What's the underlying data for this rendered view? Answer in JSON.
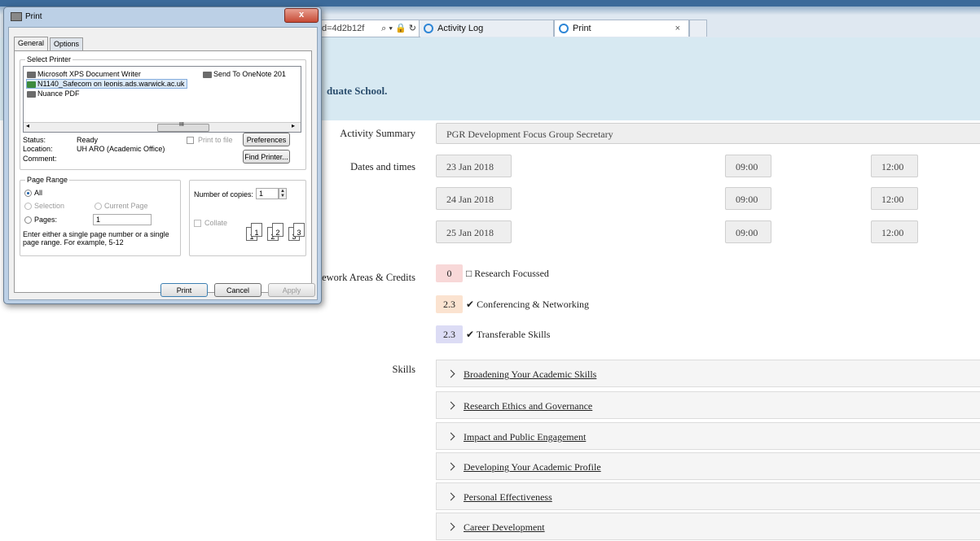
{
  "browser": {
    "address_fragment": "d=4d2b12f",
    "address_tools": "⌕ ▾ 🔒 ↻",
    "tabs": [
      {
        "label": "Activity Log",
        "active": false
      },
      {
        "label": "Print",
        "active": true,
        "close": "×"
      }
    ]
  },
  "page": {
    "header_fragment": "duate School."
  },
  "form": {
    "activity_summary_label": "Activity Summary",
    "activity_summary_value": "PGR Development Focus Group Secretary",
    "dates_label": "Dates and times",
    "dates": [
      {
        "date": "23 Jan 2018",
        "start": "09:00",
        "end": "12:00"
      },
      {
        "date": "24 Jan 2018",
        "start": "09:00",
        "end": "12:00"
      },
      {
        "date": "25 Jan 2018",
        "start": "09:00",
        "end": "12:00"
      }
    ],
    "credits_label": "mework Areas & Credits",
    "credits": [
      {
        "value": "0",
        "mark": "□",
        "label": "Research Focussed",
        "color": "#f8d8d8"
      },
      {
        "value": "2.3",
        "mark": "✔",
        "label": "Conferencing & Networking",
        "color": "#fbe3d0"
      },
      {
        "value": "2.3",
        "mark": "✔",
        "label": "Transferable Skills",
        "color": "#dcdcf5"
      }
    ],
    "skills_label": "Skills",
    "skills": [
      "Broadening Your Academic Skills",
      "Research Ethics and Governance",
      "Impact and Public Engagement",
      "Developing Your Academic Profile",
      "Personal Effectiveness",
      "Career Development"
    ]
  },
  "dialog": {
    "title": "Print",
    "close": "x",
    "tabs": [
      "General",
      "Options"
    ],
    "select_printer_label": "Select Printer",
    "printers": [
      "Microsoft XPS Document Writer",
      "Send To OneNote 201",
      "N1140_Safecom on leonis.ads.warwick.ac.uk",
      "Nuance PDF"
    ],
    "scroll_thumb_glyph": "III",
    "scroll_left": "◂",
    "scroll_right": "▸",
    "status_label": "Status:",
    "status_value": "Ready",
    "location_label": "Location:",
    "location_value": "UH ARO (Academic Office)",
    "comment_label": "Comment:",
    "print_to_file": "Print to file",
    "preferences": "Preferences",
    "find_printer": "Find Printer...",
    "page_range_label": "Page Range",
    "all": "All",
    "selection": "Selection",
    "current_page": "Current Page",
    "pages": "Pages:",
    "pages_value": "1",
    "hint_line1": "Enter either a single page number or a single",
    "hint_line2": "page range.  For example, 5-12",
    "copies_label": "Number of copies:",
    "copies_value": "1",
    "collate": "Collate",
    "collate_pages": [
      "1",
      "1",
      "2",
      "2",
      "3",
      "3"
    ],
    "print_button": "Print",
    "cancel_button": "Cancel",
    "apply_button": "Apply"
  }
}
